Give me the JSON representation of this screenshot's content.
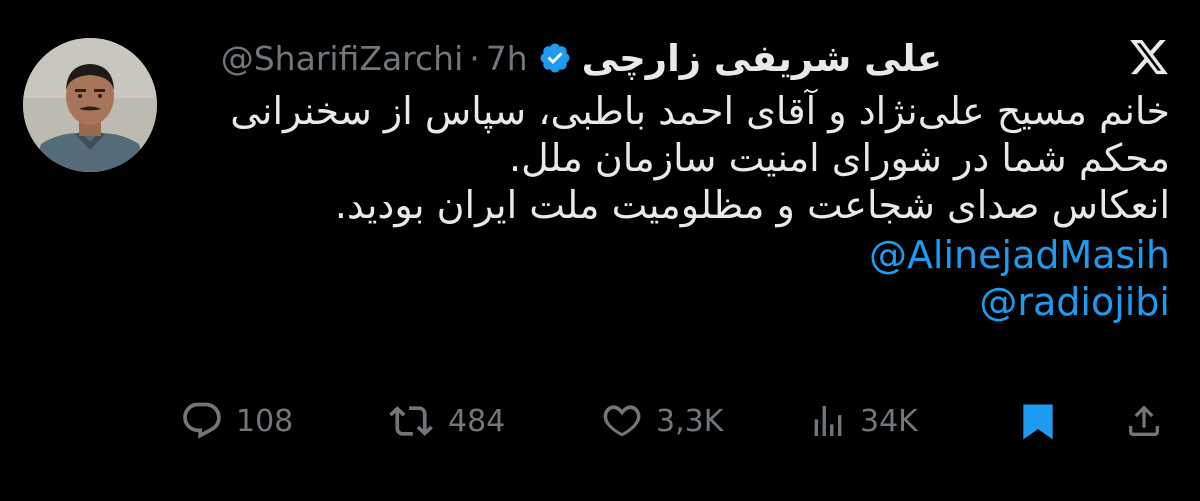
{
  "tweet": {
    "display_name": "علی شریفی زارچی",
    "handle": "@SharifiZarchi",
    "separator": "·",
    "time": "7h",
    "body_lines": [
      "خانم مسیح علی‌نژاد و آقای احمد باطبی، سپاس از سخنرانی",
      "محکم شما در شورای امنیت سازمان ملل.",
      "انعکاس صدای شجاعت و مظلومیت ملت ایران بودید."
    ],
    "mentions": [
      "@AlinejadMasih",
      "@radiojibi"
    ]
  },
  "actions": {
    "replies": "108",
    "retweets": "484",
    "likes": "3,3K",
    "views": "34K"
  },
  "colors": {
    "background": "#000000",
    "text": "#e7e9ea",
    "muted": "#71767b",
    "accent": "#1d9bf0"
  },
  "icons": {
    "close": "x-logo-icon",
    "verified": "verified-badge-icon",
    "reply": "reply-icon",
    "retweet": "retweet-icon",
    "like": "heart-icon",
    "views": "views-chart-icon",
    "bookmark": "bookmark-icon",
    "share": "share-icon"
  }
}
